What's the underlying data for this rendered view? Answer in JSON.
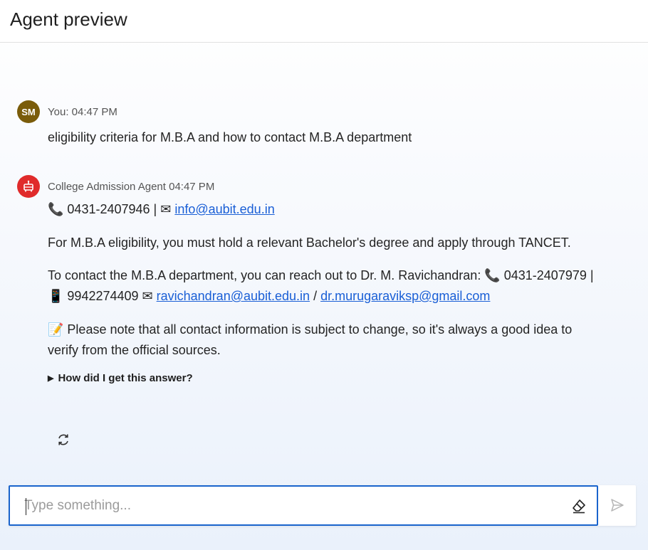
{
  "header": {
    "title": "Agent preview"
  },
  "conversation": {
    "user": {
      "initials": "SM",
      "meta": "You: 04:47 PM",
      "text": "eligibility criteria for M.B.A and how to contact M.B.A department"
    },
    "agent": {
      "meta": "College Admission Agent 04:47 PM",
      "line1_phone_icon": "📞",
      "line1_phone": " 0431-2407946 | ",
      "line1_mail_icon": "✉",
      "line1_email": "info@aubit.edu.in",
      "para2": "For M.B.A eligibility, you must hold a relevant Bachelor's degree and apply through TANCET.",
      "para3_text": "To contact the M.B.A department, you can reach out to Dr. M. Ravichandran: ",
      "para3_phone_icon": "📞",
      "para3_phone": " 0431-2407979 | ",
      "para3_mobile_icon": "📱",
      "para3_mobile": " 9942274409 ",
      "para3_mail_icon": "✉",
      "para3_email1": "ravichandran@aubit.edu.in",
      "para3_sep": " / ",
      "para3_email2": "dr.murugaraviksp@gmail.com",
      "para4_icon": "📝",
      "para4": " Please note that all contact information is subject to change, so it's always a good idea to verify from the official sources.",
      "details_label": "How did I get this answer?"
    }
  },
  "composer": {
    "placeholder": "Type something..."
  },
  "icons": {
    "regenerate": "refresh-icon",
    "clear": "eraser-icon",
    "send": "send-icon"
  },
  "colors": {
    "accent": "#1a64cc",
    "user_avatar": "#7a5c0a",
    "bot_avatar": "#e02b2b",
    "link": "#1a5fd6"
  }
}
